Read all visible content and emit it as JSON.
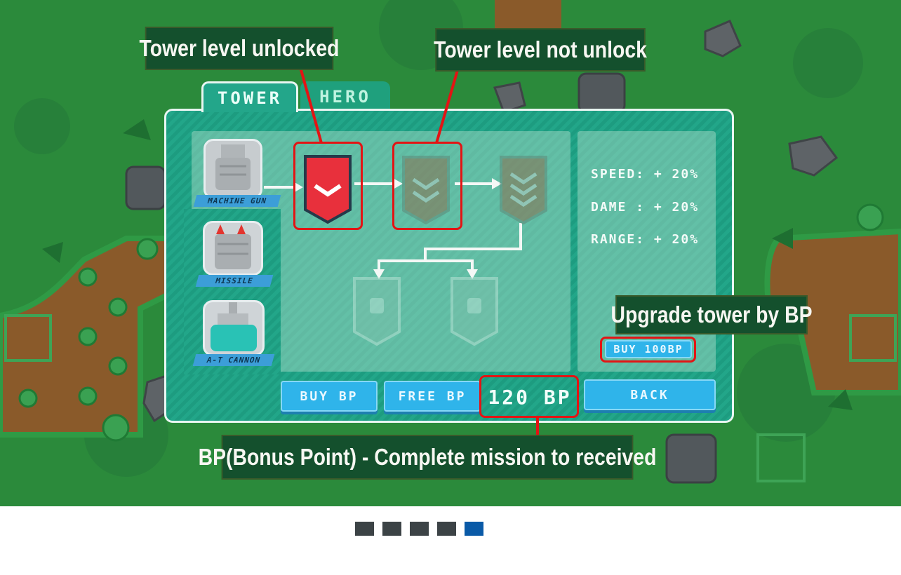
{
  "tabs": [
    {
      "label": "TOWER",
      "active": true
    },
    {
      "label": "HERO",
      "active": false
    }
  ],
  "towers": [
    {
      "label": "MACHINE GUN",
      "icon": "machine-gun-tower-icon"
    },
    {
      "label": "MISSILE",
      "icon": "missile-tower-icon"
    },
    {
      "label": "A-T CANNON",
      "icon": "at-cannon-tower-icon"
    }
  ],
  "upgrade_tree": {
    "levels": [
      {
        "icon": "rank-chevron-1-icon",
        "state": "unlocked"
      },
      {
        "icon": "rank-chevron-2-icon",
        "state": "locked"
      },
      {
        "icon": "rank-chevron-3-icon",
        "state": "locked"
      },
      {
        "icon": "rank-badge-icon",
        "state": "locked"
      },
      {
        "icon": "rank-badge-icon",
        "state": "locked"
      }
    ]
  },
  "stats": {
    "speed": "SPEED: + 20%",
    "damage": "DAME : + 20%",
    "range": "RANGE: + 20%"
  },
  "buttons": {
    "buy_tower": "BUY 100BP",
    "buy_bp": "BUY BP",
    "free_bp": "FREE BP",
    "back": "BACK"
  },
  "bp_balance": "120 BP",
  "annotations": {
    "unlocked": "Tower level unlocked",
    "locked": "Tower level not unlock",
    "upgrade": "Upgrade tower by BP",
    "bp_info": "BP(Bonus Point) - Complete mission to received"
  },
  "carousel": {
    "count": 5,
    "active_index": 4
  },
  "colors": {
    "highlight": "#e31414",
    "panel": "#1fa083",
    "button": "#2fb4ea",
    "unlocked_badge": "#e8303c"
  }
}
